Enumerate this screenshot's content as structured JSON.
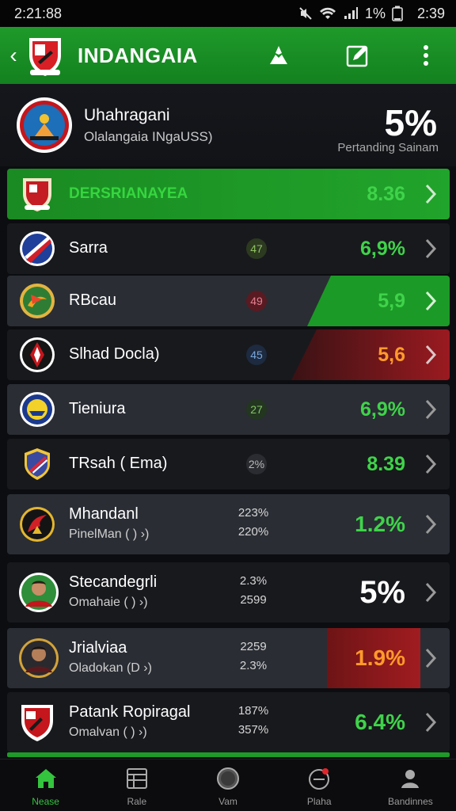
{
  "status": {
    "time": "2:21:88",
    "battery": "1%",
    "clock": "2:39"
  },
  "appbar": {
    "title": "INDANGAIA"
  },
  "header": {
    "name": "Uhahragani",
    "subtitle": "Olalangaia INgaUSS)",
    "percent": "5%",
    "percent_label": "Pertanding Sainam"
  },
  "rows": [
    {
      "name": "DERSRIANAYEA",
      "value": "8.36"
    },
    {
      "name": "Sarra",
      "badge": "47",
      "value": "6,9%"
    },
    {
      "name": "RBcau",
      "badge": "49",
      "value": "5,9"
    },
    {
      "name": "Slhad Docla)",
      "badge": "45",
      "value": "5,6"
    },
    {
      "name": "Tieniura",
      "badge": "27",
      "value": "6,9%"
    },
    {
      "name": "TRsah ( Ema)",
      "badge": "2%",
      "value": "8.39"
    },
    {
      "name": "Mhandanl",
      "sub": "PinelMan ( ) ›)",
      "stat1": "223%",
      "stat2": "220%",
      "value": "1.2%"
    },
    {
      "name": "Stecandegrli",
      "sub": "Omahaie ( ) ›)",
      "stat1": "2.3%",
      "stat2": "2599",
      "value": "5%"
    },
    {
      "name": "Jrialviaa",
      "sub": "Oladokan (D ›)",
      "stat1": "2259",
      "stat2": "2.3%",
      "value": "1.9%"
    },
    {
      "name": "Patank Ropiragal",
      "sub": "Omalvan ( ) ›)",
      "stat1": "187%",
      "stat2": "357%",
      "value": "6.4%"
    }
  ],
  "nav": [
    {
      "label": "Nease"
    },
    {
      "label": "Rale"
    },
    {
      "label": "Vam"
    },
    {
      "label": "Plaha"
    },
    {
      "label": "Bandinnes"
    }
  ],
  "colors": {
    "brand_green": "#1f9a2a",
    "value_green": "#3fd34a",
    "value_orange": "#ff9a2a",
    "alert_red": "#8b1a1c"
  }
}
